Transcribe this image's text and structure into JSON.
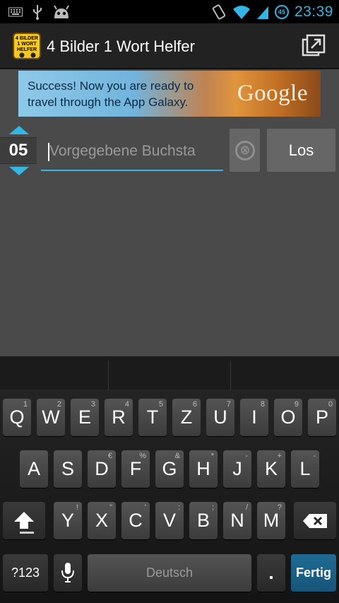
{
  "status_bar": {
    "time": "23:39",
    "battery_level": "45",
    "left_icons": [
      "keyboard-icon",
      "usb-icon",
      "android-icon"
    ],
    "right_icons": [
      "rotate-icon",
      "wifi-icon",
      "signal-icon",
      "battery-icon"
    ]
  },
  "action_bar": {
    "app_icon_lines": [
      "4 BILDER",
      "1 WORT",
      "HELFER"
    ],
    "title": "4 Bilder 1 Wort Helfer",
    "menu_icon": "window-icon"
  },
  "ad": {
    "line1": "Success! Now you are ready to",
    "line2": "travel through the App Galaxy.",
    "brand": "Google"
  },
  "number_picker": {
    "value": "05"
  },
  "letters_input": {
    "value": "",
    "placeholder": "Vorgegebene Buchsta"
  },
  "buttons": {
    "clear_label": "⊗",
    "go_label": "Los"
  },
  "keyboard": {
    "row1": [
      {
        "label": "Q",
        "hint": "1"
      },
      {
        "label": "W",
        "hint": "2"
      },
      {
        "label": "E",
        "hint": "3"
      },
      {
        "label": "R",
        "hint": "4"
      },
      {
        "label": "T",
        "hint": "5"
      },
      {
        "label": "Z",
        "hint": "6"
      },
      {
        "label": "U",
        "hint": "7"
      },
      {
        "label": "I",
        "hint": "8"
      },
      {
        "label": "O",
        "hint": "9"
      },
      {
        "label": "P",
        "hint": "0"
      }
    ],
    "row2": [
      {
        "label": "A",
        "hint": ""
      },
      {
        "label": "S",
        "hint": ""
      },
      {
        "label": "D",
        "hint": "€"
      },
      {
        "label": "F",
        "hint": "%"
      },
      {
        "label": "G",
        "hint": "&"
      },
      {
        "label": "H",
        "hint": "*"
      },
      {
        "label": "J",
        "hint": "-"
      },
      {
        "label": "K",
        "hint": "+"
      },
      {
        "label": "L",
        "hint": "-"
      }
    ],
    "row3": [
      {
        "label": "Y",
        "hint": "!"
      },
      {
        "label": "X",
        "hint": "\""
      },
      {
        "label": "C",
        "hint": "'"
      },
      {
        "label": "V",
        "hint": ":"
      },
      {
        "label": "B",
        "hint": ";"
      },
      {
        "label": "N",
        "hint": "/"
      },
      {
        "label": "M",
        "hint": "?"
      }
    ],
    "symbols_label": "?123",
    "space_label": "Deutsch",
    "period_label": ".",
    "done_label": "Fertig",
    "mic_icon": "microphone-icon",
    "shift_icon": "shift-icon",
    "backspace_icon": "backspace-icon"
  },
  "colors": {
    "accent": "#33b5e5",
    "background": "#4a4a4a",
    "action_bar": "#222222",
    "done_key": "#1e6b95"
  }
}
